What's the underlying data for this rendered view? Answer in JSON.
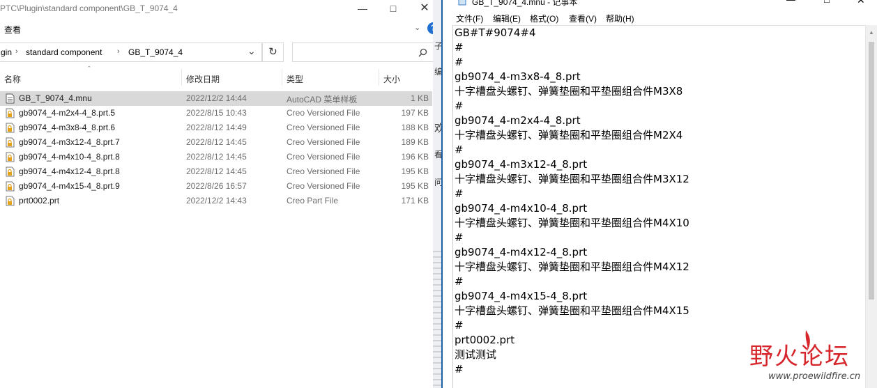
{
  "explorer": {
    "title_path": "PTC\\Plugin\\standard component\\GB_T_9074_4",
    "ribbon_tab": "查看",
    "help_glyph": "?",
    "breadcrumbs": [
      "gin",
      "standard component",
      "GB_T_9074_4"
    ],
    "search_placeholder": "",
    "columns": {
      "name": "名称",
      "date": "修改日期",
      "type": "类型",
      "size": "大小"
    },
    "files": [
      {
        "name": "GB_T_9074_4.mnu",
        "date": "2022/12/2 14:44",
        "type": "AutoCAD 菜单样板",
        "size": "1 KB",
        "icon": "text-file-icon",
        "selected": true
      },
      {
        "name": "gb9074_4-m2x4-4_8.prt.5",
        "date": "2022/8/15 10:43",
        "type": "Creo Versioned File",
        "size": "197 KB",
        "icon": "locked-file-icon",
        "selected": false
      },
      {
        "name": "gb9074_4-m3x8-4_8.prt.6",
        "date": "2022/8/12 14:49",
        "type": "Creo Versioned File",
        "size": "188 KB",
        "icon": "locked-file-icon",
        "selected": false
      },
      {
        "name": "gb9074_4-m3x12-4_8.prt.7",
        "date": "2022/8/12 14:45",
        "type": "Creo Versioned File",
        "size": "189 KB",
        "icon": "locked-file-icon",
        "selected": false
      },
      {
        "name": "gb9074_4-m4x10-4_8.prt.8",
        "date": "2022/8/12 14:45",
        "type": "Creo Versioned File",
        "size": "196 KB",
        "icon": "locked-file-icon",
        "selected": false
      },
      {
        "name": "gb9074_4-m4x12-4_8.prt.8",
        "date": "2022/8/12 14:45",
        "type": "Creo Versioned File",
        "size": "195 KB",
        "icon": "locked-file-icon",
        "selected": false
      },
      {
        "name": "gb9074_4-m4x15-4_8.prt.9",
        "date": "2022/8/26 16:57",
        "type": "Creo Versioned File",
        "size": "195 KB",
        "icon": "locked-file-icon",
        "selected": false
      },
      {
        "name": "prt0002.prt",
        "date": "2022/12/2 14:43",
        "type": "Creo Part File",
        "size": "171 KB",
        "icon": "locked-file-icon",
        "selected": false
      }
    ]
  },
  "background_fragments": [
    "子",
    "编",
    "欢",
    "看",
    "问"
  ],
  "notepad": {
    "title": "GB_T_9074_4.mnu - 记事本",
    "menu": [
      "文件(F)",
      "编辑(E)",
      "格式(O)",
      "查看(V)",
      "帮助(H)"
    ],
    "lines": [
      "GB#T#9074#4",
      "#",
      "#",
      "gb9074_4-m3x8-4_8.prt",
      "十字槽盘头螺钉、弹簧垫圈和平垫圈组合件M3X8",
      "#",
      "gb9074_4-m2x4-4_8.prt",
      "十字槽盘头螺钉、弹簧垫圈和平垫圈组合件M2X4",
      "#",
      "gb9074_4-m3x12-4_8.prt",
      "十字槽盘头螺钉、弹簧垫圈和平垫圈组合件M3X12",
      "#",
      "gb9074_4-m4x10-4_8.prt",
      "十字槽盘头螺钉、弹簧垫圈和平垫圈组合件M4X10",
      "#",
      "gb9074_4-m4x12-4_8.prt",
      "十字槽盘头螺钉、弹簧垫圈和平垫圈组合件M4X12",
      "#",
      "gb9074_4-m4x15-4_8.prt",
      "十字槽盘头螺钉、弹簧垫圈和平垫圈组合件M4X15",
      "#",
      "prt0002.prt",
      "测试测试",
      "#"
    ]
  },
  "watermark": {
    "text": "野火论坛",
    "url": "www.proewildfire.cn"
  },
  "colors": {
    "selection": "#d9d9d9",
    "watermark": "#d7262b",
    "accent": "#1f5fa8"
  }
}
